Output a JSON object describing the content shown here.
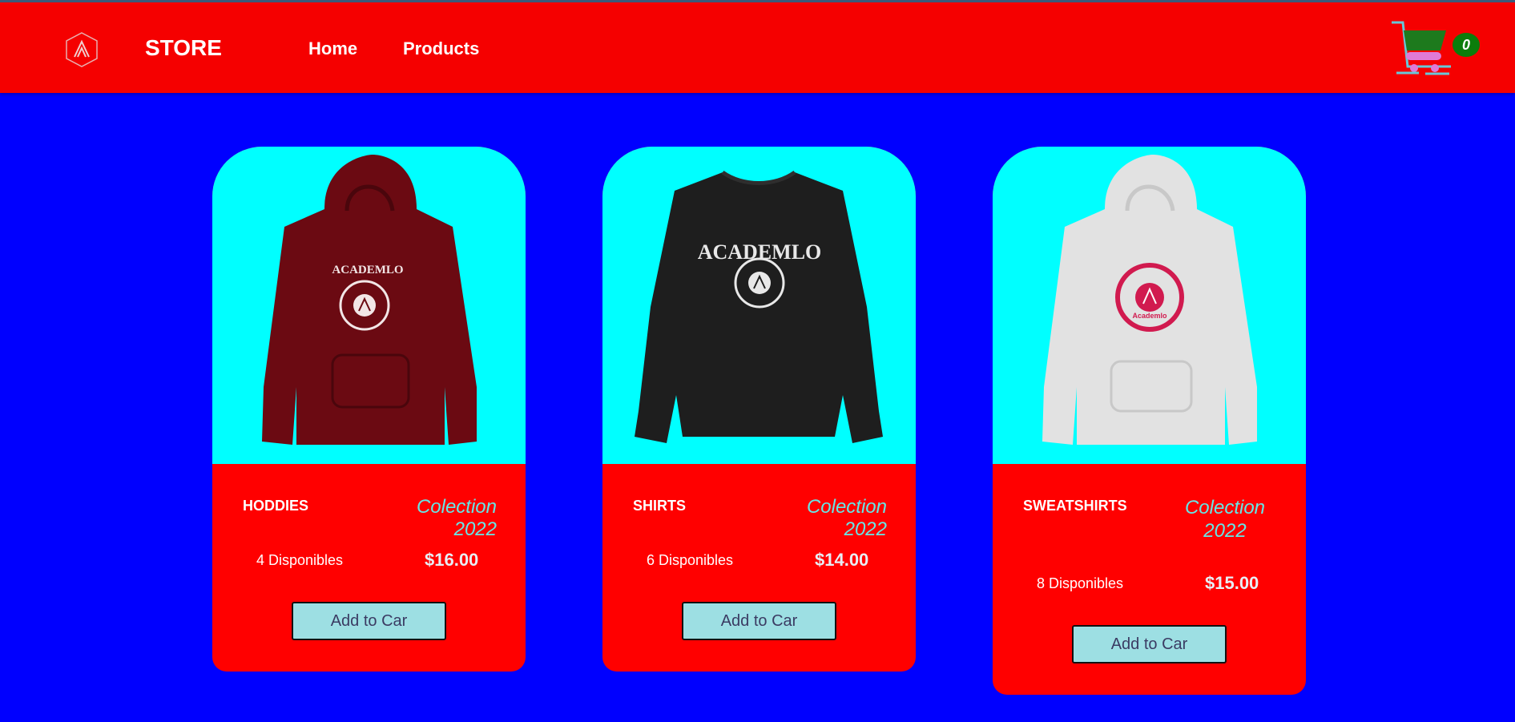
{
  "nav": {
    "brand": "STORE",
    "links": [
      {
        "label": "Home"
      },
      {
        "label": "Products"
      }
    ],
    "cart_count": "0"
  },
  "products": [
    {
      "name": "HODDIES",
      "collection": "Colection 2022",
      "stock": "4 Disponibles",
      "price": "$16.00",
      "button": "Add to Car",
      "image": "maroon-hoodie",
      "image_text": "ACADEMLO",
      "color": "#6b0a12"
    },
    {
      "name": "SHIRTS",
      "collection": "Colection 2022",
      "stock": "6 Disponibles",
      "price": "$14.00",
      "button": "Add to Car",
      "image": "black-sweater",
      "image_text": "ACADEMLO",
      "color": "#1e1e1e"
    },
    {
      "name": "SWEATSHIRTS",
      "collection": "Colection 2022",
      "stock": "8 Disponibles",
      "price": "$15.00",
      "button": "Add to Car",
      "image": "gray-hoodie",
      "image_text": "Academlo",
      "color": "#e2e2e2"
    }
  ],
  "colors": {
    "navbar": "#f50000",
    "background": "#0000ff",
    "card_top": "#00ffff",
    "card_bottom": "#ff0000",
    "button": "#9ddfe3",
    "badge": "#0b7d0b"
  }
}
